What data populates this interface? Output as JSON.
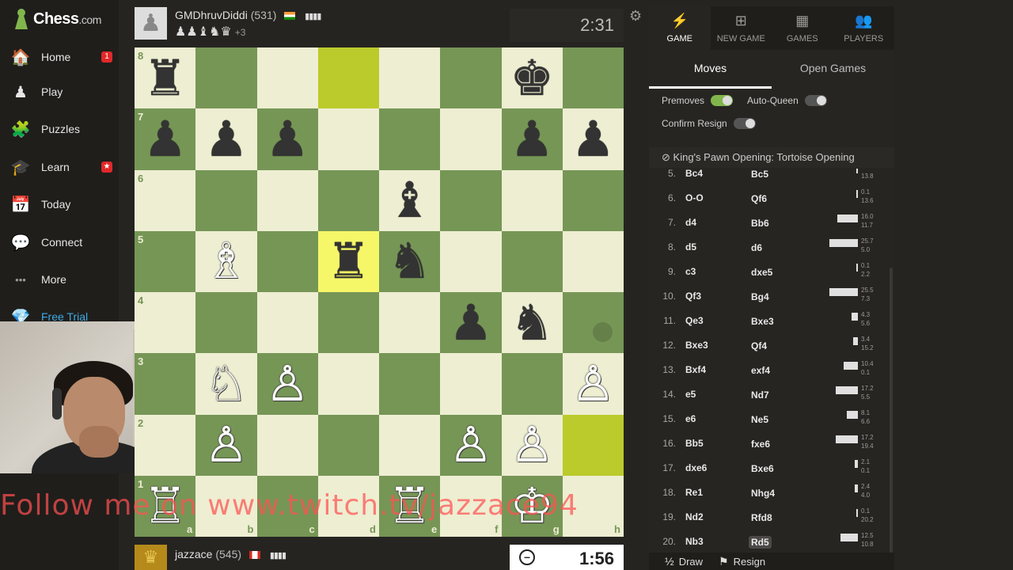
{
  "sidebar": {
    "logo": "Chess",
    "logo_suffix": ".com",
    "items": [
      {
        "label": "Home",
        "icon": "home-icon",
        "glyph": "🏠",
        "badge": "1"
      },
      {
        "label": "Play",
        "icon": "play-icon",
        "glyph": "♟",
        "badge": null
      },
      {
        "label": "Puzzles",
        "icon": "puzzles-icon",
        "glyph": "🧩",
        "badge": null
      },
      {
        "label": "Learn",
        "icon": "learn-icon",
        "glyph": "🎓",
        "badge": "★"
      },
      {
        "label": "Today",
        "icon": "today-icon",
        "glyph": "📅",
        "badge": null
      },
      {
        "label": "Connect",
        "icon": "connect-icon",
        "glyph": "💬",
        "badge": null
      },
      {
        "label": "More",
        "icon": "more-icon",
        "glyph": "•••",
        "badge": null
      },
      {
        "label": "Free Trial",
        "icon": "diamond-icon",
        "glyph": "💎",
        "badge": null
      }
    ]
  },
  "top_player": {
    "name": "GMDhruvDiddi",
    "rating": "(531)",
    "captured": "♟♟♝♞♛",
    "advantage": "+3",
    "clock": "2:31"
  },
  "bottom_player": {
    "name": "jazzace",
    "rating": "(545)",
    "clock": "1:56"
  },
  "board": {
    "ranks": [
      "8",
      "7",
      "6",
      "5",
      "4",
      "3",
      "2",
      "1"
    ],
    "files": [
      "a",
      "b",
      "c",
      "d",
      "e",
      "f",
      "g",
      "h"
    ],
    "highlights": [
      "d8",
      "d5",
      "h2"
    ],
    "pieces": {
      "a8": {
        "c": "b",
        "t": "♜"
      },
      "g8": {
        "c": "b",
        "t": "♚"
      },
      "a7": {
        "c": "b",
        "t": "♟"
      },
      "b7": {
        "c": "b",
        "t": "♟"
      },
      "c7": {
        "c": "b",
        "t": "♟"
      },
      "g7": {
        "c": "b",
        "t": "♟"
      },
      "h7": {
        "c": "b",
        "t": "♟"
      },
      "e6": {
        "c": "b",
        "t": "♝"
      },
      "b5": {
        "c": "w",
        "t": "♗"
      },
      "d5": {
        "c": "b",
        "t": "♜"
      },
      "e5": {
        "c": "b",
        "t": "♞"
      },
      "f4": {
        "c": "b",
        "t": "♟"
      },
      "g4": {
        "c": "b",
        "t": "♞"
      },
      "b3": {
        "c": "w",
        "t": "♘"
      },
      "c3": {
        "c": "w",
        "t": "♙"
      },
      "h3": {
        "c": "w",
        "t": "♙"
      },
      "b2": {
        "c": "w",
        "t": "♙"
      },
      "f2": {
        "c": "w",
        "t": "♙"
      },
      "g2": {
        "c": "w",
        "t": "♙"
      },
      "a1": {
        "c": "w",
        "t": "♖"
      },
      "e1": {
        "c": "w",
        "t": "♖"
      },
      "g1": {
        "c": "w",
        "t": "♔"
      }
    },
    "dots": [
      "h4"
    ]
  },
  "overlay_text": "Follow me on www.twitch.tv/jazzace94",
  "panel": {
    "tabs": [
      {
        "label": "GAME",
        "glyph": "⚡",
        "icon": "lightning-icon"
      },
      {
        "label": "NEW GAME",
        "glyph": "⊞",
        "icon": "plus-square-icon"
      },
      {
        "label": "GAMES",
        "glyph": "▦",
        "icon": "board-icon"
      },
      {
        "label": "PLAYERS",
        "glyph": "👥",
        "icon": "players-icon"
      }
    ],
    "subtabs": [
      "Moves",
      "Open Games"
    ],
    "toggles": {
      "premoves": "Premoves",
      "auto_queen": "Auto-Queen",
      "confirm_resign": "Confirm Resign"
    },
    "opening": "King's Pawn Opening: Tortoise Opening",
    "moves": [
      {
        "n": "5.",
        "w": "Bc4",
        "b": "Bc5",
        "t1": "",
        "t2": "13.8",
        "bar": 0
      },
      {
        "n": "6.",
        "w": "O-O",
        "b": "Qf6",
        "t1": "0.1",
        "t2": "13.6",
        "bar": 2
      },
      {
        "n": "7.",
        "w": "d4",
        "b": "Bb6",
        "t1": "16.0",
        "t2": "11.7",
        "bar": 26
      },
      {
        "n": "8.",
        "w": "d5",
        "b": "d6",
        "t1": "25.7",
        "t2": "5.0",
        "bar": 36
      },
      {
        "n": "9.",
        "w": "c3",
        "b": "dxe5",
        "t1": "0.1",
        "t2": "2.2",
        "bar": 2
      },
      {
        "n": "10.",
        "w": "Qf3",
        "b": "Bg4",
        "t1": "25.5",
        "t2": "7.3",
        "bar": 36
      },
      {
        "n": "11.",
        "w": "Qe3",
        "b": "Bxe3",
        "t1": "4.3",
        "t2": "5.6",
        "bar": 8
      },
      {
        "n": "12.",
        "w": "Bxe3",
        "b": "Qf4",
        "t1": "3.4",
        "t2": "15.2",
        "bar": 6
      },
      {
        "n": "13.",
        "w": "Bxf4",
        "b": "exf4",
        "t1": "10.4",
        "t2": "0.1",
        "bar": 18
      },
      {
        "n": "14.",
        "w": "e5",
        "b": "Nd7",
        "t1": "17.2",
        "t2": "5.5",
        "bar": 28
      },
      {
        "n": "15.",
        "w": "e6",
        "b": "Ne5",
        "t1": "8.1",
        "t2": "6.6",
        "bar": 14
      },
      {
        "n": "16.",
        "w": "Bb5",
        "b": "fxe6",
        "t1": "17.2",
        "t2": "19.4",
        "bar": 28
      },
      {
        "n": "17.",
        "w": "dxe6",
        "b": "Bxe6",
        "t1": "2.1",
        "t2": "0.1",
        "bar": 4
      },
      {
        "n": "18.",
        "w": "Re1",
        "b": "Nhg4",
        "t1": "2.4",
        "t2": "4.0",
        "bar": 4
      },
      {
        "n": "19.",
        "w": "Nd2",
        "b": "Rfd8",
        "t1": "0.1",
        "t2": "20.2",
        "bar": 2
      },
      {
        "n": "20.",
        "w": "Nb3",
        "b": "Rd5",
        "t1": "12.5",
        "t2": "10.8",
        "bar": 22
      }
    ],
    "actions": {
      "draw": "Draw",
      "resign": "Resign"
    }
  }
}
